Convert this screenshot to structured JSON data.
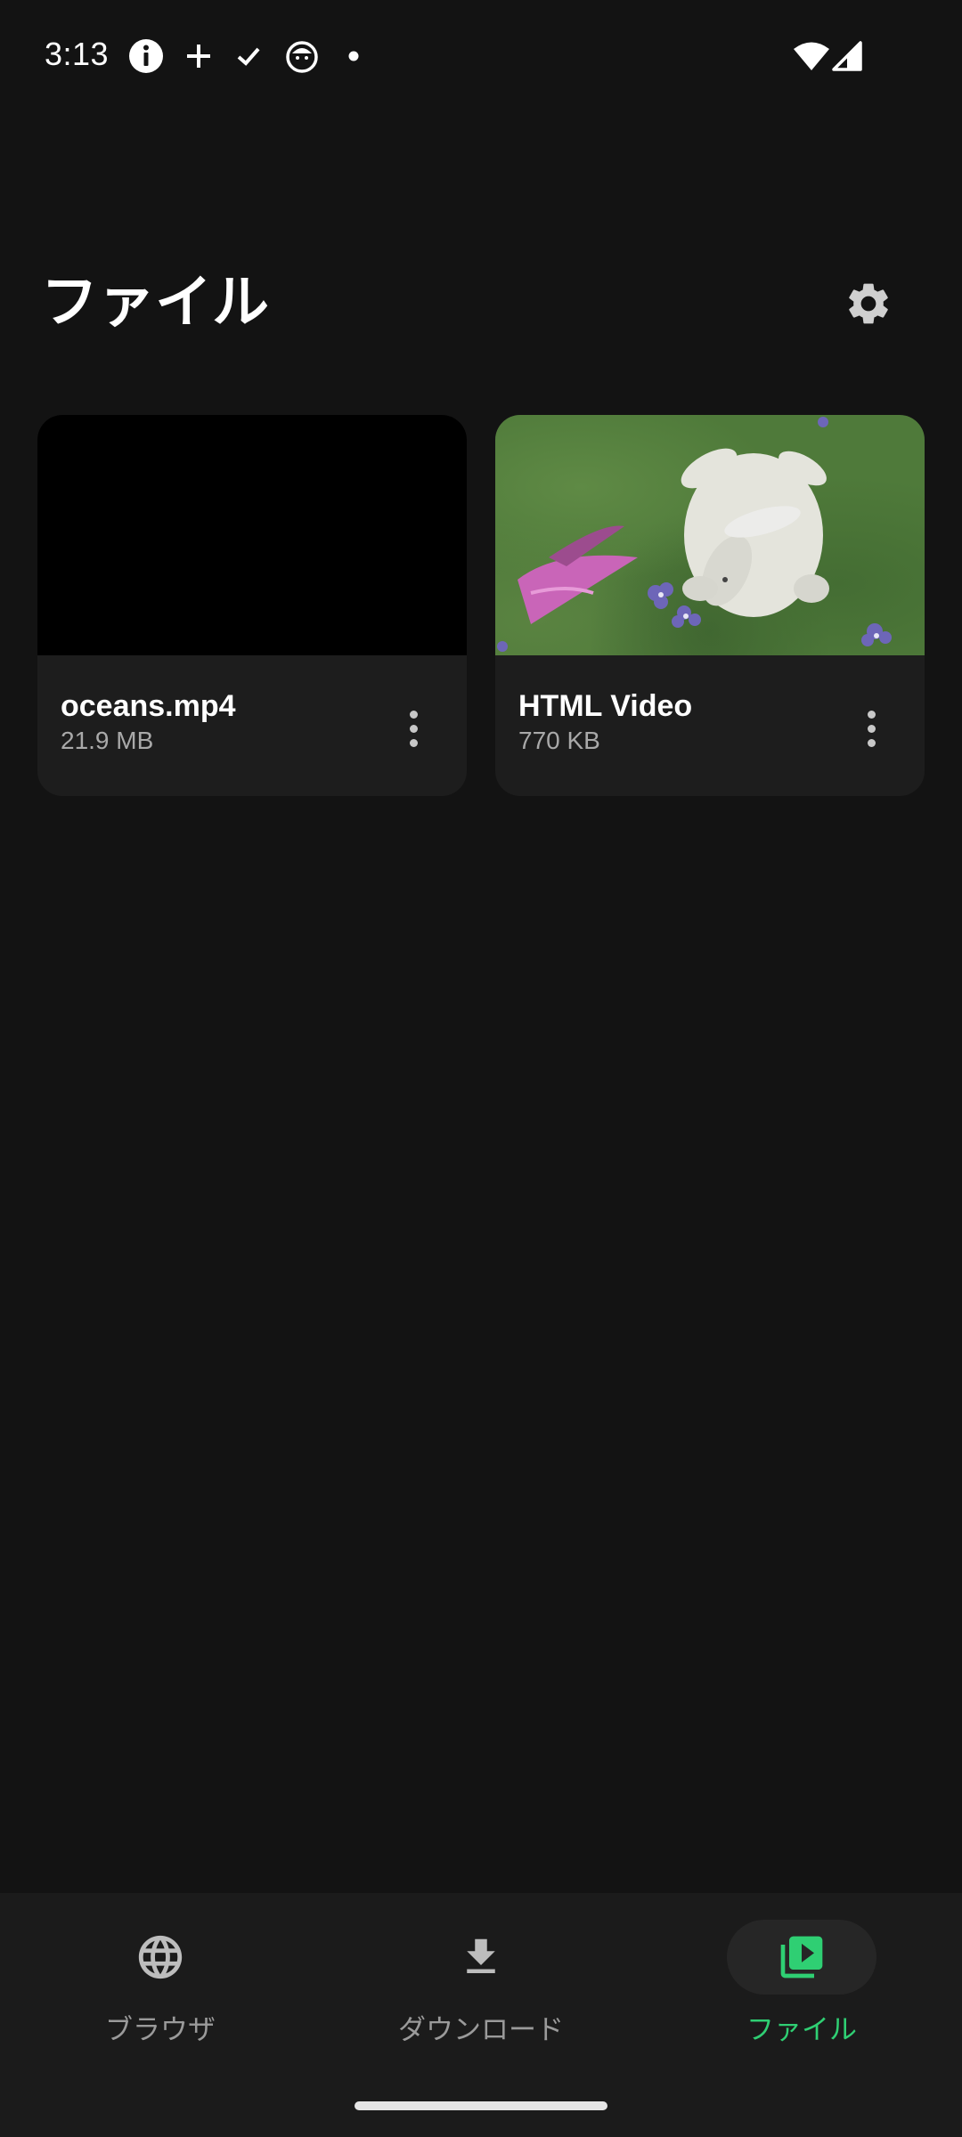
{
  "status_bar": {
    "time": "3:13",
    "notification_icons": [
      "info-icon",
      "plus-icon",
      "check-icon",
      "cat-icon",
      "dot-icon"
    ],
    "system_icons": [
      "wifi-icon",
      "cell-signal-icon"
    ]
  },
  "header": {
    "title": "ファイル",
    "settings_icon": "gear-icon"
  },
  "files": [
    {
      "name": "oceans.mp4",
      "size": "21.9 MB",
      "thumbnail": "black"
    },
    {
      "name": "HTML Video",
      "size": "770 KB",
      "thumbnail": "bunny-on-grass"
    }
  ],
  "bottom_nav": {
    "items": [
      {
        "label": "ブラウザ",
        "icon": "globe-icon",
        "active": false
      },
      {
        "label": "ダウンロード",
        "icon": "download-icon",
        "active": false
      },
      {
        "label": "ファイル",
        "icon": "video-library-icon",
        "active": true
      }
    ]
  },
  "colors": {
    "background": "#131313",
    "card": "#1d1d1d",
    "nav_background": "#1b1b1b",
    "accent": "#2fcf73",
    "secondary_text": "#a9a9a9"
  }
}
